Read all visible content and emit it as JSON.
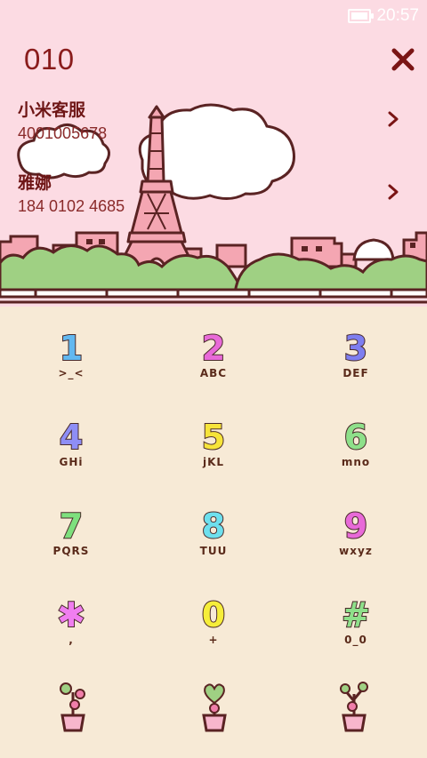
{
  "status_bar": {
    "time": "20:57",
    "battery_icon": "battery-icon"
  },
  "dialer": {
    "input_value": "010"
  },
  "contacts": [
    {
      "name": "小米客服",
      "number": "4001005678"
    },
    {
      "name": "雅娜",
      "number": "184 0102 4685"
    }
  ],
  "keys": [
    {
      "digit": "1",
      "letters": ">_<",
      "color": "#62b8f0"
    },
    {
      "digit": "2",
      "letters": "ABC",
      "color": "#e86ad8"
    },
    {
      "digit": "3",
      "letters": "DEF",
      "color": "#7e7ef0"
    },
    {
      "digit": "4",
      "letters": "GHi",
      "color": "#8e8ef6"
    },
    {
      "digit": "5",
      "letters": "jKL",
      "color": "#f6e43a"
    },
    {
      "digit": "6",
      "letters": "mno",
      "color": "#8ee08a"
    },
    {
      "digit": "7",
      "letters": "PQRS",
      "color": "#7ee07e"
    },
    {
      "digit": "8",
      "letters": "TUU",
      "color": "#6ee0ee"
    },
    {
      "digit": "9",
      "letters": "wxyz",
      "color": "#e86ad8"
    },
    {
      "digit": "✱",
      "letters": ",",
      "color": "#f07ef0"
    },
    {
      "digit": "0",
      "letters": "+",
      "color": "#f6ee3a"
    },
    {
      "digit": "#",
      "letters": "0_0",
      "color": "#8ee08a"
    }
  ],
  "colors": {
    "sky": "#fcdbe3",
    "keypad_bg": "#f7ead6",
    "text_dark": "#6e1515",
    "bush": "#9fd083",
    "building": "#f4a6b2"
  }
}
